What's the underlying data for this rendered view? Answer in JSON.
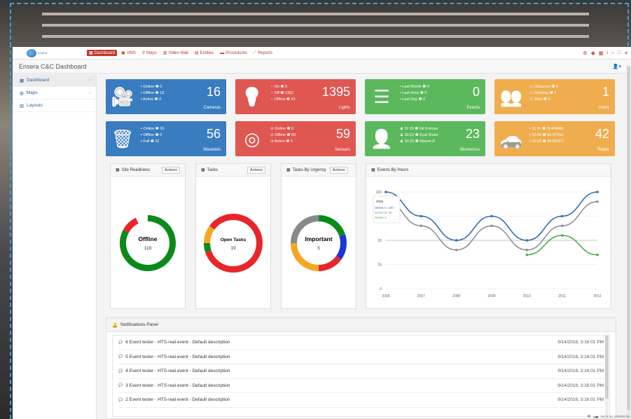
{
  "app": {
    "logo_text": "EnsEra",
    "title": "Ensera C&C Dashboard"
  },
  "nav": {
    "tabs": [
      {
        "label": "Dashboard",
        "icon": "dashboard-icon",
        "glyph": "▦"
      },
      {
        "label": "VMS",
        "icon": "vms-icon",
        "glyph": "▣"
      },
      {
        "label": "Maps",
        "icon": "map-marker-icon",
        "glyph": "⚲"
      },
      {
        "label": "Video Wall",
        "icon": "video-wall-icon",
        "glyph": "▥"
      },
      {
        "label": "Entities",
        "icon": "entities-icon",
        "glyph": "▤"
      },
      {
        "label": "Procedures",
        "icon": "procedures-icon",
        "glyph": "▬"
      },
      {
        "label": "Reports",
        "icon": "reports-icon",
        "glyph": "⟋"
      }
    ],
    "controls": [
      "⚙",
      "◉",
      "▦",
      "i",
      "–",
      "□",
      "✕"
    ]
  },
  "sidebar": {
    "items": [
      {
        "label": "Dashboard",
        "icon": "dashboard-icon",
        "glyph": "▦"
      },
      {
        "label": "Maps",
        "icon": "globe-icon",
        "glyph": "◍"
      },
      {
        "label": "Layouts",
        "icon": "layouts-icon",
        "glyph": "▥"
      }
    ]
  },
  "tiles": [
    {
      "color": "blue",
      "icon": "camera-icon",
      "glyph": "🎥",
      "lines": [
        "▪ Online ❶ 0",
        "▪ Offline ❶ 16",
        "▪ Active ❶ 0"
      ],
      "value": "16",
      "label": "Cameras"
    },
    {
      "color": "red",
      "icon": "lightbulb-icon",
      "glyph": "💡",
      "lines": [
        "♀ On ❶ 0",
        "♀ Off ❶ 1352",
        "♀ Offline ❶ 43"
      ],
      "value": "1395",
      "label": "Lights"
    },
    {
      "color": "green",
      "icon": "server-icon",
      "glyph": "☰",
      "lines": [
        "▪ Last Month ❶ 0",
        "▪ Last Hour ❶ 0",
        "▪ Last Day ❶ 0"
      ],
      "value": "0",
      "label": "Events"
    },
    {
      "color": "orange",
      "icon": "users-icon",
      "glyph": "👥",
      "lines": [
        "☺ Observer ❶ 0",
        "☺ Desktop ❶ 1",
        "☺ Web ❶ 0"
      ],
      "value": "1",
      "label": "Users"
    },
    {
      "color": "blue",
      "icon": "trash-icon",
      "glyph": "🗑",
      "lines": [
        "▪ Online ❶ 10",
        "▪ Offline ❶ 0",
        "▪ Full ❶ 22"
      ],
      "value": "56",
      "label": "Wastebin"
    },
    {
      "color": "red",
      "icon": "target-icon",
      "glyph": "◎",
      "lines": [
        "⊙ Online ❶ 0",
        "⊙ Offline ❶ 59",
        "⊙ Active ❶ 0"
      ],
      "value": "59",
      "label": "Sensors"
    },
    {
      "color": "green",
      "icon": "user-icon",
      "glyph": "👤",
      "lines": [
        "♟ 11:15 ❶ Gil Froines",
        "♟ 10:12 ❶ Eyal Shani",
        "♟ 10:22 ❶ Mason R"
      ],
      "value": "23",
      "label": "Biometrics"
    },
    {
      "color": "orange",
      "icon": "car-icon",
      "glyph": "🚗",
      "lines": [
        "▪ 11:11 ❶ 11464HM",
        "▪ 10:43 ❶ 50-97991",
        "▪ 10:22 ❶ 89780317"
      ],
      "value": "42",
      "label": "Plates"
    }
  ],
  "panels": {
    "site_readiness": {
      "title": "Site Readiness",
      "actions": "Actions",
      "center_title": "Offline",
      "center_value": "118",
      "slices": [
        {
          "value": 83,
          "color": "#0a8a1a"
        },
        {
          "value": 10,
          "color": "#e8262a"
        },
        {
          "value": 7,
          "color": "#ffffff"
        }
      ]
    },
    "tasks": {
      "title": "Tasks",
      "actions": "Actions",
      "center_title": "Open Tasks",
      "center_value": "19",
      "slices": [
        {
          "value": 70,
          "color": "#e8262a"
        },
        {
          "value": 5,
          "color": "#0a8a1a"
        },
        {
          "value": 10,
          "color": "#f5a623"
        },
        {
          "value": 15,
          "color": "#e8262a"
        }
      ]
    },
    "tasks_urgency": {
      "title": "Tasks By Urgency",
      "actions": "Actions",
      "center_title": "Important",
      "center_value": "5",
      "slices": [
        {
          "value": 20,
          "color": "#0a8a1a"
        },
        {
          "value": 15,
          "color": "#1a35d8"
        },
        {
          "value": 15,
          "color": "#e8262a"
        },
        {
          "value": 25,
          "color": "#f5a623"
        },
        {
          "value": 25,
          "color": "#888888"
        }
      ]
    }
  },
  "chart_data": {
    "type": "line",
    "title": "Events By Hours",
    "x": [
      2006,
      2007,
      2008,
      2009,
      2010,
      2011,
      2012
    ],
    "ylim": [
      0,
      100
    ],
    "yticks": [
      0,
      25,
      50,
      75,
      100
    ],
    "series": [
      {
        "name": "Series A",
        "color": "#2f6fb0",
        "values": [
          100,
          75,
          50,
          75,
          50,
          75,
          100
        ]
      },
      {
        "name": "Series B",
        "color": "#8a8f96",
        "values": [
          90,
          65,
          40,
          65,
          40,
          65,
          90
        ]
      },
      {
        "name": "Series C",
        "color": "#4cae4c",
        "values": [
          null,
          null,
          null,
          null,
          35,
          55,
          35
        ]
      }
    ],
    "tooltip": {
      "x": "2006",
      "lines": [
        "Series A: 100",
        "Series B: 90",
        "Series C"
      ]
    }
  },
  "notifications": {
    "title": "Notifications Panel",
    "rows": [
      {
        "text": "6 Event tester - HTS-real event - Default description",
        "ts": "9/14/2016, 3:16:01 PM"
      },
      {
        "text": "5 Event tester - HTS-real event - Default description",
        "ts": "9/14/2016, 3:16:01 PM"
      },
      {
        "text": "4 Event tester - HTS-real event - Default description",
        "ts": "9/14/2016, 3:16:01 PM"
      },
      {
        "text": "3 Event tester - HTS-real event - Default description",
        "ts": "9/14/2016, 3:16:01 PM"
      },
      {
        "text": "2 Event tester - HTS-real event - Default description",
        "ts": "9/14/2016, 3:16:01 PM"
      }
    ]
  },
  "statusbar": {
    "text": "04:11:31 16/09/2016"
  }
}
